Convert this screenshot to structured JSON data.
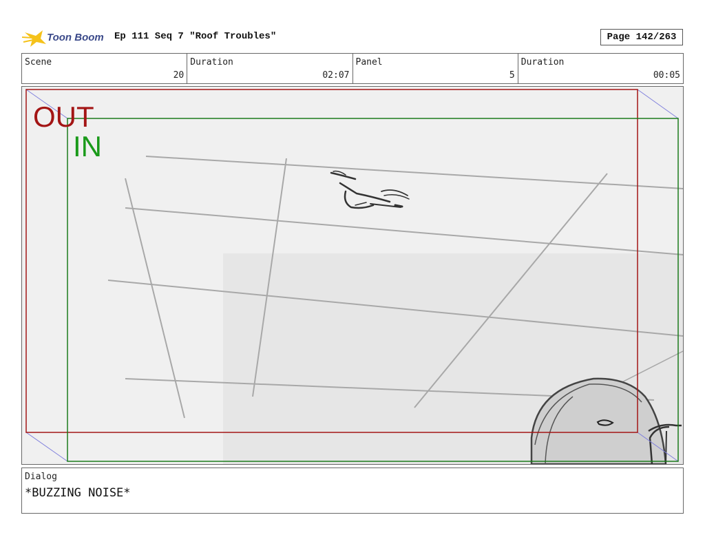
{
  "header": {
    "logo_text": "Toon Boom",
    "title": "Ep 111 Seq 7 \"Roof Troubles\"",
    "page": "Page 142/263"
  },
  "info": {
    "scene_label": "Scene",
    "scene_value": "20",
    "scene_duration_label": "Duration",
    "scene_duration_value": "02:07",
    "panel_label": "Panel",
    "panel_value": "5",
    "panel_duration_label": "Duration",
    "panel_duration_value": "00:05"
  },
  "panel": {
    "out_label": "OUT",
    "in_label": "IN",
    "out_color": "#a31515",
    "in_color": "#1a9a1a"
  },
  "dialog": {
    "label": "Dialog",
    "text": "*BUZZING NOISE*"
  },
  "colors": {
    "logo_star": "#f5c21b",
    "logo_text": "#3b4a8a"
  }
}
